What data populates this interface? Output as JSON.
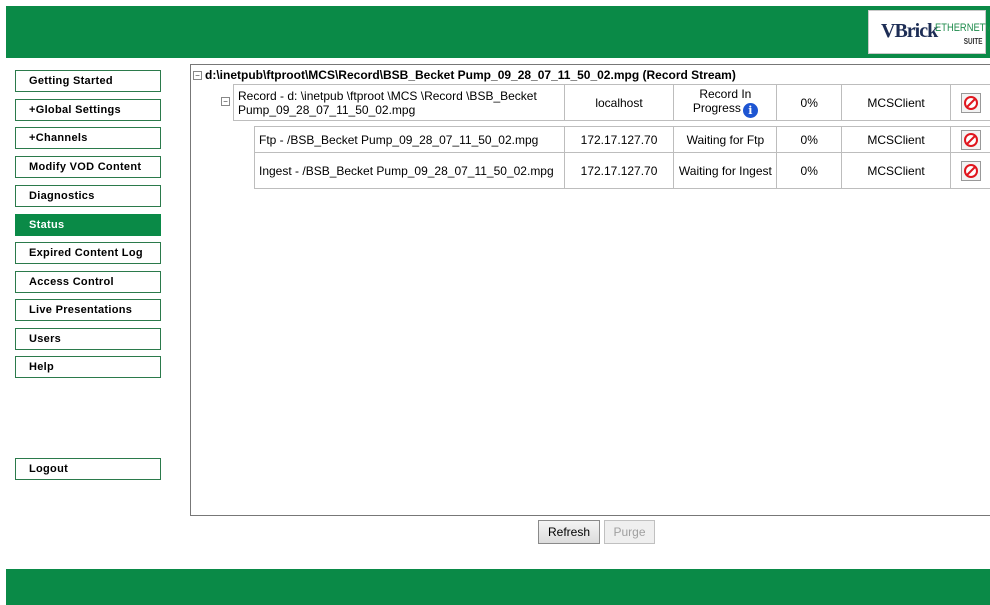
{
  "brand": {
    "logo_main": "VBrick",
    "logo_sub": "ETHERNETV",
    "logo_suite": "SUITE"
  },
  "nav": {
    "items": [
      {
        "label": "Getting Started",
        "active": false
      },
      {
        "label": "+Global Settings",
        "active": false
      },
      {
        "label": "+Channels",
        "active": false
      },
      {
        "label": "Modify VOD Content",
        "active": false
      },
      {
        "label": "Diagnostics",
        "active": false
      },
      {
        "label": "Status",
        "active": true
      },
      {
        "label": "Expired Content Log",
        "active": false
      },
      {
        "label": "Access Control",
        "active": false
      },
      {
        "label": "Live Presentations",
        "active": false
      },
      {
        "label": "Users",
        "active": false
      },
      {
        "label": "Help",
        "active": false
      }
    ],
    "logout": "Logout"
  },
  "status": {
    "root": {
      "toggle": "−",
      "label": "d:\\inetpub\\ftproot\\MCS\\Record\\BSB_Becket Pump_09_28_07_11_50_02.mpg (Record Stream)"
    },
    "record": {
      "toggle": "−",
      "name": "Record - d: \\inetpub \\ftproot \\MCS \\Record \\BSB_Becket Pump_09_28_07_11_50_02.mpg",
      "host": "localhost",
      "state": "Record In Progress",
      "state_line1": "Record In",
      "state_line2": "Progress",
      "info_icon": "i",
      "percent": "0%",
      "client": "MCSClient"
    },
    "subtasks": [
      {
        "name": "Ftp - /BSB_Becket Pump_09_28_07_11_50_02.mpg",
        "host": "172.17.127.70",
        "state": "Waiting for Ftp",
        "percent": "0%",
        "client": "MCSClient"
      },
      {
        "name": "Ingest - /BSB_Becket Pump_09_28_07_11_50_02.mpg",
        "host": "172.17.127.70",
        "state": "Waiting for Ingest",
        "percent": "0%",
        "client": "MCSClient"
      }
    ]
  },
  "actions": {
    "refresh": "Refresh",
    "purge": "Purge"
  },
  "icons": {
    "stop": "stop-icon",
    "info": "info-icon"
  },
  "colors": {
    "accent": "#0a8a47",
    "stop": "#e0161e",
    "info": "#1d55d2"
  }
}
